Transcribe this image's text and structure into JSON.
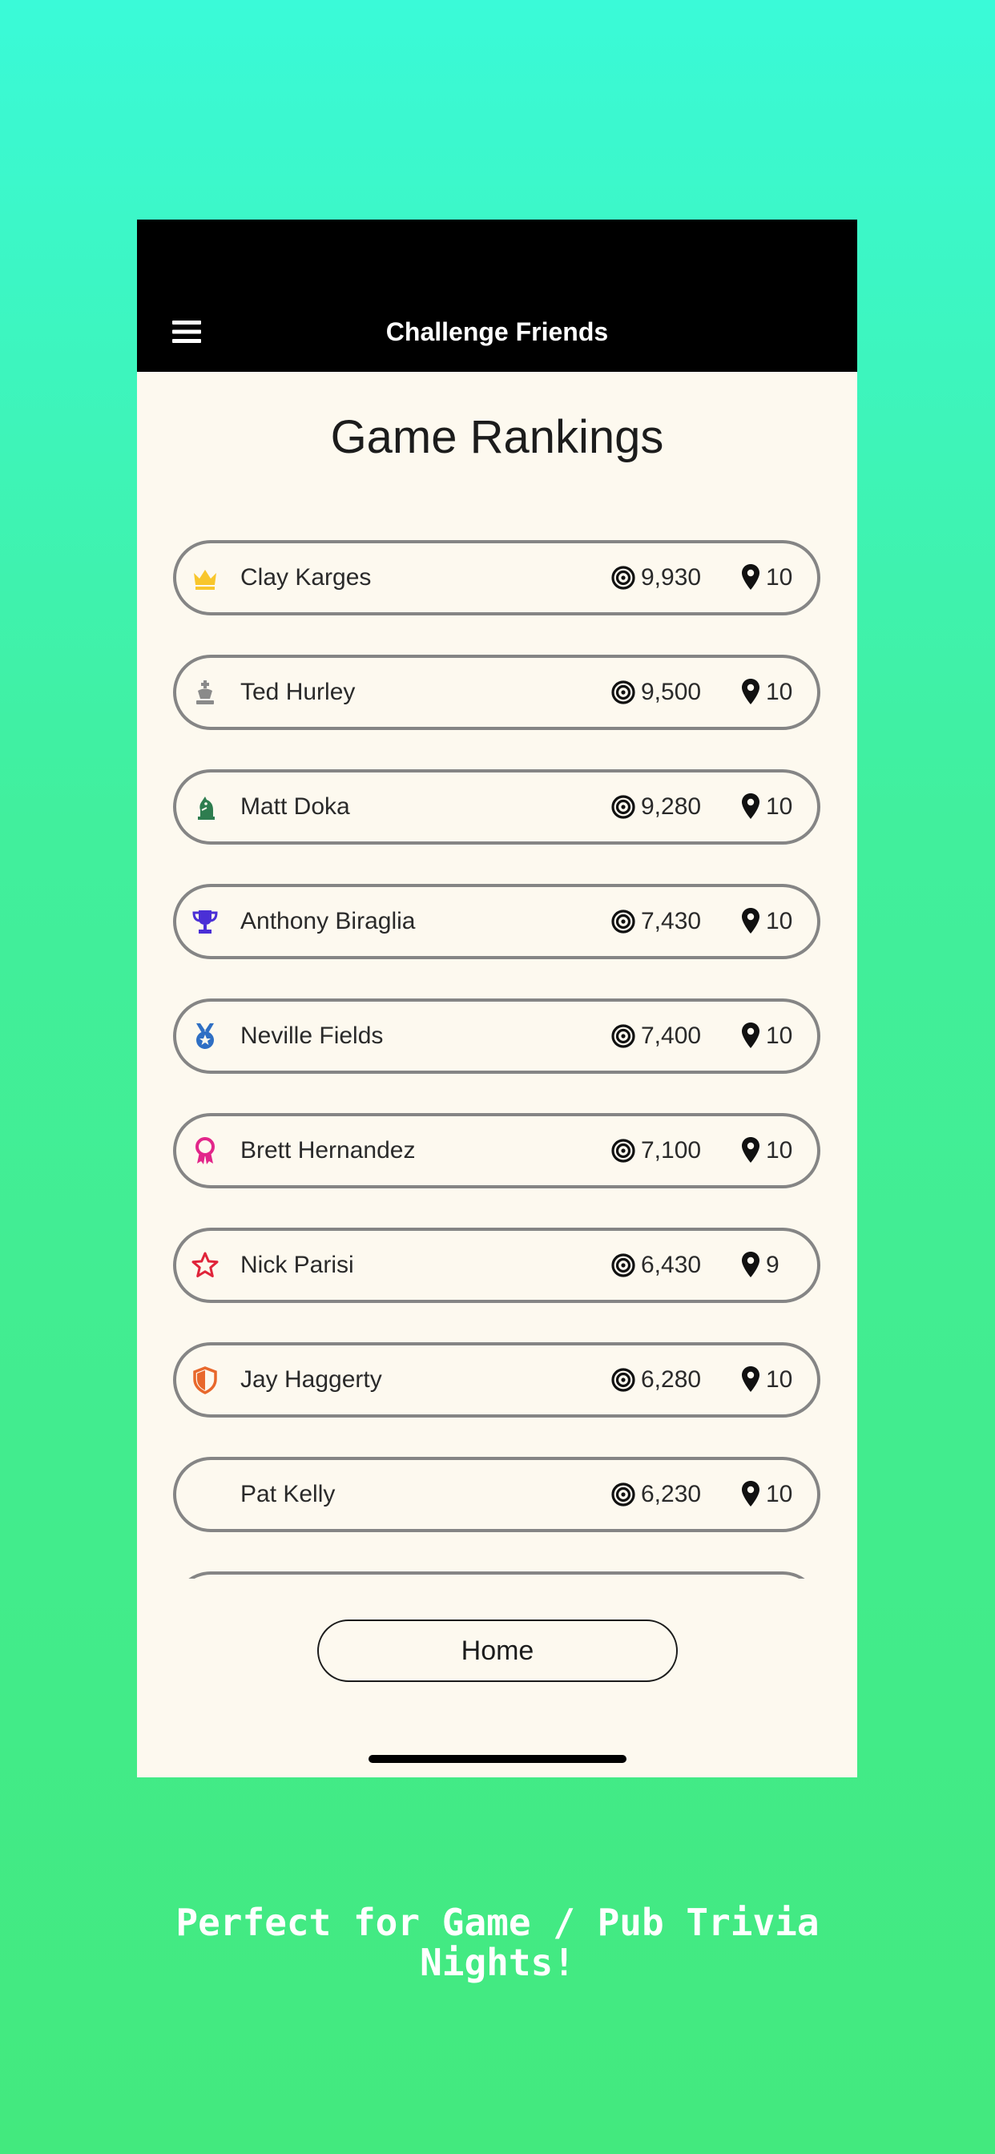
{
  "nav": {
    "title": "Challenge Friends",
    "menu_icon": "hamburger-menu-icon"
  },
  "page": {
    "title": "Game Rankings"
  },
  "rankings": [
    {
      "icon": "crown-icon",
      "icon_color": "#f8c62c",
      "name": "Clay Karges",
      "score": "9,930",
      "rounds": "10"
    },
    {
      "icon": "chess-king-icon",
      "icon_color": "#8a8a8a",
      "name": "Ted Hurley",
      "score": "9,500",
      "rounds": "10"
    },
    {
      "icon": "chess-knight-icon",
      "icon_color": "#2e7d4f",
      "name": "Matt Doka",
      "score": "9,280",
      "rounds": "10"
    },
    {
      "icon": "trophy-icon",
      "icon_color": "#4a2fd6",
      "name": "Anthony Biraglia",
      "score": "7,430",
      "rounds": "10"
    },
    {
      "icon": "medal-icon",
      "icon_color": "#2f6fc4",
      "name": "Neville Fields",
      "score": "7,400",
      "rounds": "10"
    },
    {
      "icon": "award-ribbon-icon",
      "icon_color": "#e2268a",
      "name": "Brett Hernandez",
      "score": "7,100",
      "rounds": "10"
    },
    {
      "icon": "star-outline-icon",
      "icon_color": "#e0243a",
      "name": "Nick Parisi",
      "score": "6,430",
      "rounds": "9"
    },
    {
      "icon": "shield-icon",
      "icon_color": "#e8682c",
      "name": "Jay Haggerty",
      "score": "6,280",
      "rounds": "10"
    },
    {
      "icon": "",
      "icon_color": "",
      "name": "Pat Kelly",
      "score": "6,230",
      "rounds": "10"
    }
  ],
  "score_icon": "target-icon",
  "rounds_icon": "map-pin-icon",
  "home_button": {
    "label": "Home"
  },
  "caption": {
    "line1": "Perfect for Game / Pub Trivia",
    "line2": "Nights!"
  },
  "colors": {
    "nav_background": "#000000",
    "screen_background": "#fdf9ef",
    "row_border": "#858585",
    "gradient_top": "#3afad8",
    "gradient_bottom": "#43e97e"
  }
}
